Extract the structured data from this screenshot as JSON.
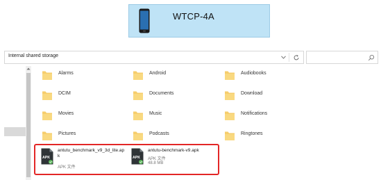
{
  "device": {
    "name": "WTCP-4A",
    "icon": "phone-icon"
  },
  "pathbar": {
    "path": "Internal shared storage"
  },
  "search": {
    "placeholder": ""
  },
  "folders": [
    {
      "label": "Alarms"
    },
    {
      "label": "Android"
    },
    {
      "label": "Audiobooks"
    },
    {
      "label": "DCIM"
    },
    {
      "label": "Documents"
    },
    {
      "label": "Download"
    },
    {
      "label": "Movies"
    },
    {
      "label": "Music"
    },
    {
      "label": "Notifications"
    },
    {
      "label": "Pictures"
    },
    {
      "label": "Podcasts"
    },
    {
      "label": "Ringtones"
    }
  ],
  "apk_files": [
    {
      "name": "antutu_benchmark_v9_3d_lite.apk",
      "type": "APK 文件",
      "size": ""
    },
    {
      "name": "antutu-benchmark-v9.apk",
      "type": "APK 文件",
      "size": "48.8 MB"
    }
  ],
  "colors": {
    "device_box": "#bfe3f6",
    "folder": "#f6cd6c",
    "highlight": "#e32626",
    "apk_icon": "#2f3437",
    "apk_badge": "#5cb85c"
  }
}
